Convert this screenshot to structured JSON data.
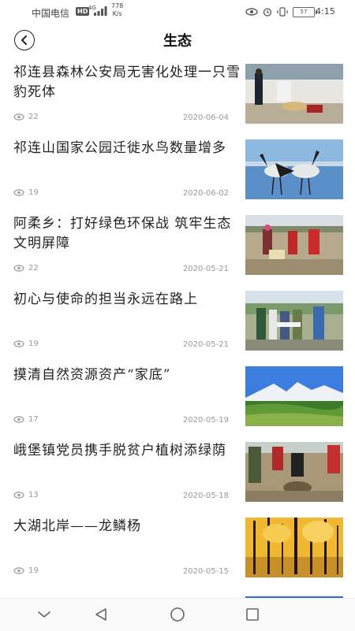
{
  "status_bar": {
    "carrier": "中国电信",
    "hd": "HD",
    "network": "4G",
    "speed_value": "778",
    "speed_unit": "K/s",
    "battery": "57",
    "time": "4:15"
  },
  "header": {
    "title": "生态",
    "back_icon": "chevron-left-icon"
  },
  "news": [
    {
      "title": "祁连县森林公安局无害化处理一只雪豹死体",
      "views": "22",
      "date": "2020-06-04",
      "image": "officers-handling-snow-leopard-photo"
    },
    {
      "title": "祁连山国家公园迁徙水鸟数量增多",
      "views": "19",
      "date": "2020-06-02",
      "image": "black-necked-cranes-photo"
    },
    {
      "title": "阿柔乡：打好绿色环保战 筑牢生态文明屏障",
      "views": "22",
      "date": "2020-05-21",
      "image": "volunteers-cleaning-photo"
    },
    {
      "title": "初心与使命的担当永远在路上",
      "views": "19",
      "date": "2020-05-21",
      "image": "field-inspection-photo"
    },
    {
      "title": "摸清自然资源资产“家底”",
      "views": "17",
      "date": "2020-05-19",
      "image": "snow-mountain-grassland-photo"
    },
    {
      "title": "峨堡镇党员携手脱贫户植树添绿荫",
      "views": "13",
      "date": "2020-05-18",
      "image": "tree-planting-photo"
    },
    {
      "title": "大湖北岸——龙鳞杨",
      "views": "19",
      "date": "2020-05-15",
      "image": "golden-poplar-forest-photo"
    }
  ],
  "nav_bar": {
    "icons": [
      "chevron-down-icon",
      "back-triangle-icon",
      "home-circle-icon",
      "recent-square-icon"
    ]
  }
}
